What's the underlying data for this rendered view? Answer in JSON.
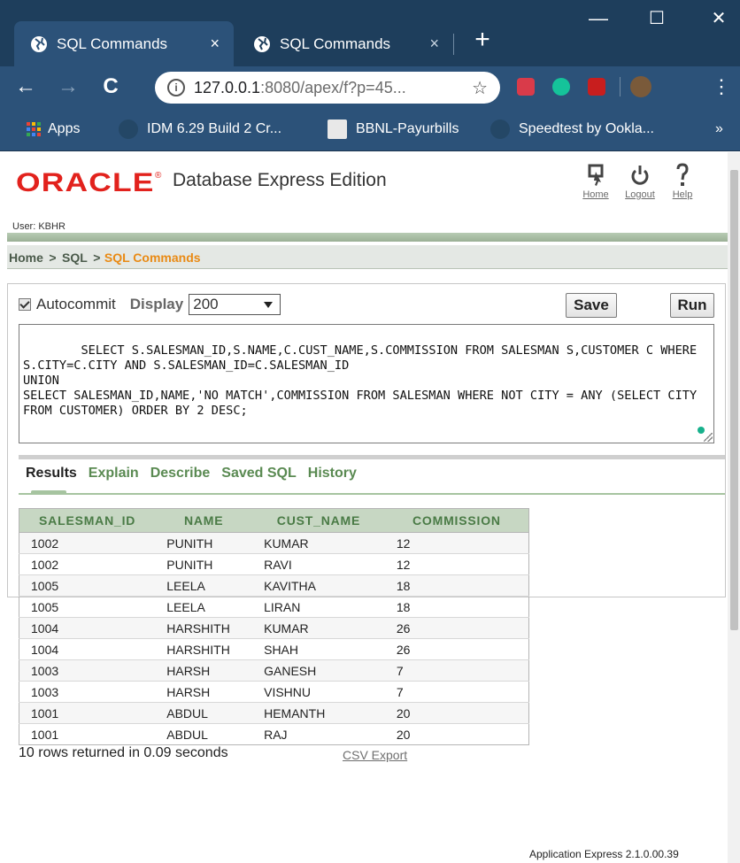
{
  "browser": {
    "tabs": [
      {
        "title": "SQL Commands",
        "close": "×"
      },
      {
        "title": "SQL Commands",
        "close": "×"
      }
    ],
    "new_tab": "+",
    "window_controls": {
      "minimize": "—",
      "maximize": "☐",
      "close": "✕"
    },
    "nav": {
      "back": "←",
      "forward": "→",
      "reload": "C",
      "menu": "⋮"
    },
    "url_host": "127.0.0.1",
    "url_rest": ":8080/apex/f?p=45...",
    "bookmarks": [
      "Apps",
      "IDM 6.29 Build 2 Cr...",
      "BBNL-Payurbills",
      "Speedtest by Ookla..."
    ],
    "bookmarks_more": "»"
  },
  "header": {
    "logo": "ORACLE",
    "product": "Database Express Edition",
    "links": {
      "home": "Home",
      "logout": "Logout",
      "help": "Help"
    },
    "user": "User: KBHR"
  },
  "breadcrumb": {
    "home": "Home",
    "sql": "SQL",
    "sep": ">",
    "current": "SQL Commands"
  },
  "editor": {
    "autocommit_label": "Autocommit",
    "autocommit_checked": true,
    "display_label": "Display",
    "display_value": "200",
    "save": "Save",
    "run": "Run",
    "sql": "SELECT S.SALESMAN_ID,S.NAME,C.CUST_NAME,S.COMMISSION FROM SALESMAN S,CUSTOMER C WHERE S.CITY=C.CITY AND S.SALESMAN_ID=C.SALESMAN_ID\nUNION\nSELECT SALESMAN_ID,NAME,'NO MATCH',COMMISSION FROM SALESMAN WHERE NOT CITY = ANY (SELECT CITY FROM CUSTOMER) ORDER BY 2 DESC;"
  },
  "result_tabs": [
    "Results",
    "Explain",
    "Describe",
    "Saved SQL",
    "History"
  ],
  "table": {
    "columns": [
      "SALESMAN_ID",
      "NAME",
      "CUST_NAME",
      "COMMISSION"
    ],
    "rows": [
      [
        "1002",
        "PUNITH",
        "KUMAR",
        "12"
      ],
      [
        "1002",
        "PUNITH",
        "RAVI",
        "12"
      ],
      [
        "1005",
        "LEELA",
        "KAVITHA",
        "18"
      ],
      [
        "1005",
        "LEELA",
        "LIRAN",
        "18"
      ],
      [
        "1004",
        "HARSHITH",
        "KUMAR",
        "26"
      ],
      [
        "1004",
        "HARSHITH",
        "SHAH",
        "26"
      ],
      [
        "1003",
        "HARSH",
        "GANESH",
        "7"
      ],
      [
        "1003",
        "HARSH",
        "VISHNU",
        "7"
      ],
      [
        "1001",
        "ABDUL",
        "HEMANTH",
        "20"
      ],
      [
        "1001",
        "ABDUL",
        "RAJ",
        "20"
      ]
    ]
  },
  "status": {
    "row_count": "10 rows returned in 0.09 seconds",
    "csv_export": "CSV Export"
  },
  "footer": "Application Express 2.1.0.00.39",
  "colors": {
    "oracle_red": "#e2221d",
    "tab_green": "#5a8a52",
    "crumb_orange": "#e98a14",
    "chrome_blue": "#2c5279"
  }
}
